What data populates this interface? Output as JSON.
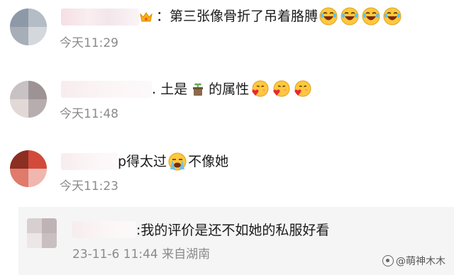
{
  "comments": [
    {
      "text_prefix": "：第三张像骨折了吊着胳膊",
      "emojis": [
        "laughing-tears-emoji",
        "laughing-tears-emoji",
        "laughing-tears-emoji",
        "laughing-tears-emoji"
      ],
      "time": "今天11:29"
    },
    {
      "text_prefix": ". 土是",
      "text_suffix": "的属性",
      "inline_icon": "flower-pot-emoji",
      "emojis": [
        "heart-hug-emoji",
        "heart-hug-emoji",
        "heart-hug-emoji"
      ],
      "time": "今天11:48"
    },
    {
      "text_prefix": "p得太过",
      "text_suffix": "不像她",
      "inline_icon": "crying-face-emoji",
      "time": "今天11:23"
    }
  ],
  "reply": {
    "text": ":我的评价是还不如她的私服好看",
    "time": "23-11-6 11:44 来自湖南"
  },
  "watermark": {
    "text": "@萌神木木"
  },
  "colors": {
    "time_gray": "#8a8a8a",
    "reply_bg": "#f5f5f5",
    "emoji_yellow": "#ffc83d"
  }
}
